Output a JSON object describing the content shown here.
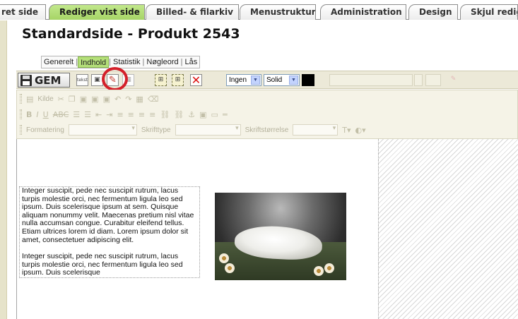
{
  "tabs": [
    {
      "label": "ret side",
      "active": false
    },
    {
      "label": "Rediger vist side",
      "active": true
    },
    {
      "label": "Billed- & filarkiv",
      "active": false
    },
    {
      "label": "Menustruktur",
      "active": false
    },
    {
      "label": "Administration",
      "active": false
    },
    {
      "label": "Design",
      "active": false
    },
    {
      "label": "Skjul redige",
      "active": false
    }
  ],
  "page": {
    "title": "Standardside - Produkt 2543"
  },
  "subtabs": [
    {
      "label": "Generelt",
      "active": false
    },
    {
      "label": "Indhold",
      "active": true
    },
    {
      "label": "Statistik",
      "active": false
    },
    {
      "label": "Nøgleord",
      "active": false
    },
    {
      "label": "Lås",
      "active": false
    }
  ],
  "toolbar": {
    "save_label": "GEM",
    "text_icon_label": "tekst",
    "border_select": "Ingen",
    "style_select": "Solid",
    "accent_color": "#d4202a"
  },
  "editor_toolbar": {
    "source_label": "Kilde",
    "format_label": "Formatering",
    "font_label": "Skrifttype",
    "size_label": "Skriftstørrelse"
  },
  "content": {
    "paragraph1": "Integer suscipit, pede nec suscipit rutrum, lacus turpis molestie orci, nec fermentum ligula leo sed ipsum. Duis scelerisque ipsum at sem. Quisque aliquam nonummy velit. Maecenas pretium nisl vitae nulla accumsan congue. Curabitur eleifend tellus. Etiam ultrices lorem id diam. Lorem ipsum dolor sit amet, consectetuer adipiscing elit.",
    "paragraph2": "Integer suscipit, pede nec suscipit rutrum, lacus turpis molestie orci, nec fermentum ligula leo sed ipsum. Duis scelerisque"
  }
}
